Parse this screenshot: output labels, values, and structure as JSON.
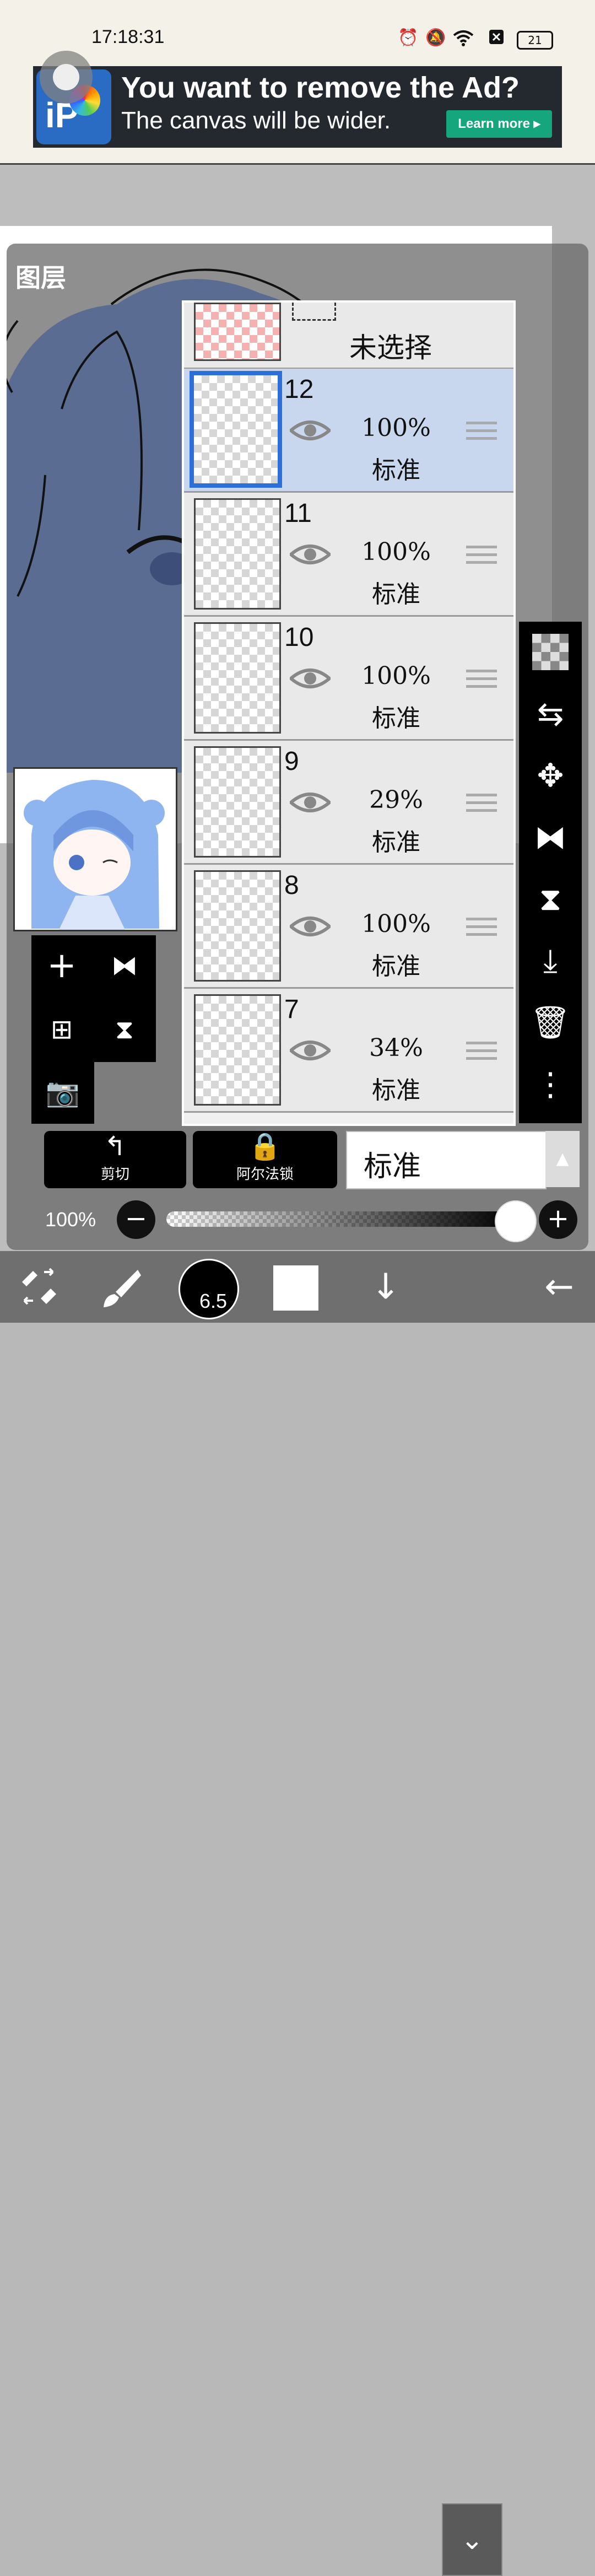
{
  "status_bar": {
    "time": "17:18:31",
    "icons": [
      "alarm-icon",
      "mute-icon",
      "wifi-icon",
      "sim-icon"
    ],
    "battery": "21"
  },
  "ad": {
    "title": "You want to remove the Ad?",
    "subtitle": "The canvas will be wider.",
    "button": "Learn more ▸",
    "logo_text": "iP"
  },
  "panel": {
    "title": "图层"
  },
  "unselected": {
    "label": "未选择"
  },
  "layers": [
    {
      "name": "12",
      "opacity": "100%",
      "mode": "标准",
      "selected": true
    },
    {
      "name": "11",
      "opacity": "100%",
      "mode": "标准",
      "selected": false
    },
    {
      "name": "10",
      "opacity": "100%",
      "mode": "标准",
      "selected": false
    },
    {
      "name": "9",
      "opacity": "29%",
      "mode": "标准",
      "selected": false
    },
    {
      "name": "8",
      "opacity": "100%",
      "mode": "标准",
      "selected": false
    },
    {
      "name": "7",
      "opacity": "34%",
      "mode": "标准",
      "selected": false
    }
  ],
  "right_toolbar": [
    "checker-icon",
    "layer-swap-icon",
    "move-icon",
    "flip-horizontal-icon",
    "flip-vertical-icon",
    "merge-down-icon",
    "trash-icon",
    "more-icon"
  ],
  "bottom_controls": {
    "clip_label": "剪切",
    "alpha_lock_label": "阿尔法锁",
    "blend_mode": "标准",
    "opacity": "100%",
    "opacity_value": 1.0
  },
  "toolbar": {
    "brush_size": "6.5"
  },
  "colors": {
    "accent": "#2c6fd8",
    "selected_row": "#c8d7ee",
    "ad_button": "#16a67e"
  }
}
